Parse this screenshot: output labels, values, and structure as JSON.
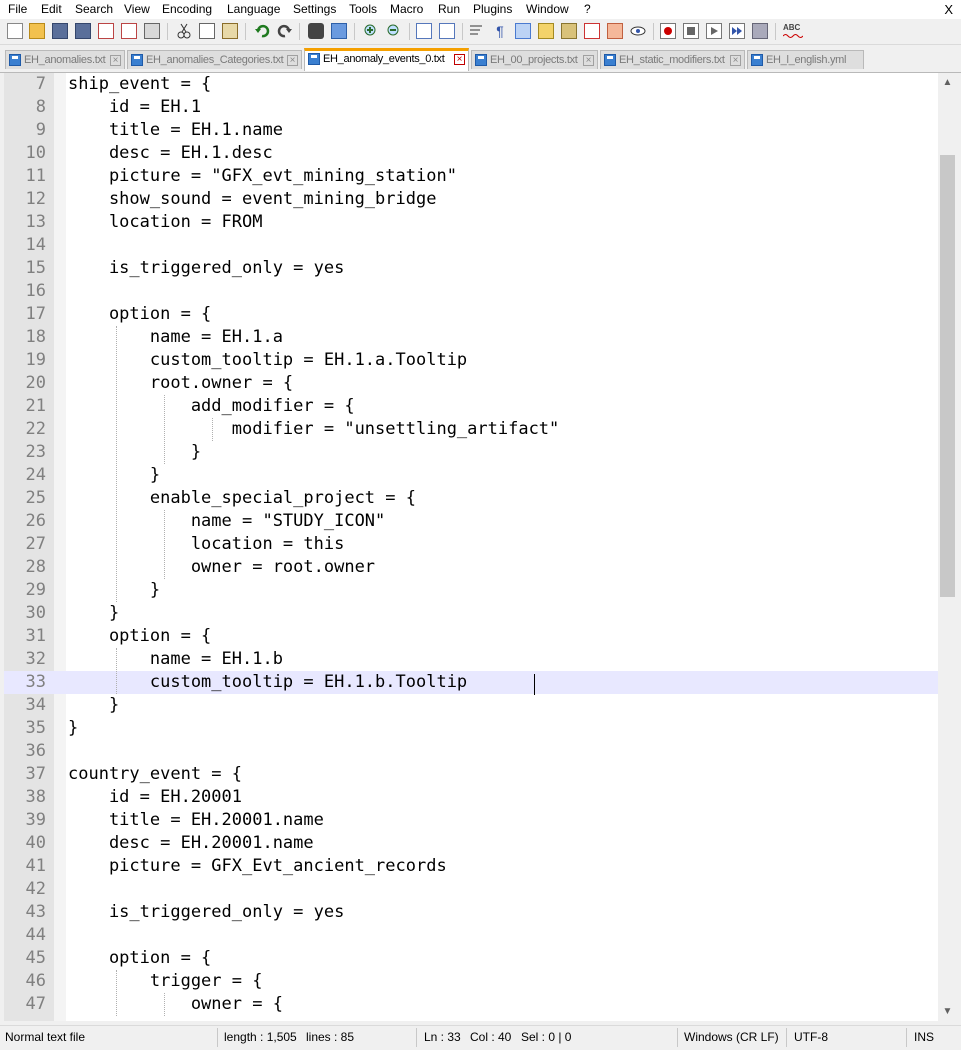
{
  "menu": [
    "File",
    "Edit",
    "Search",
    "View",
    "Encoding",
    "Language",
    "Settings",
    "Tools",
    "Macro",
    "Run",
    "Plugins",
    "Window",
    "?"
  ],
  "close_label": "X",
  "tabs": [
    {
      "label": "EH_anomalies.txt",
      "active": false
    },
    {
      "label": "EH_anomalies_Categories.txt",
      "active": false
    },
    {
      "label": "EH_anomaly_events_0.txt",
      "active": true
    },
    {
      "label": "EH_00_projects.txt",
      "active": false
    },
    {
      "label": "EH_static_modifiers.txt",
      "active": false
    },
    {
      "label": "EH_l_english.yml",
      "active": false
    }
  ],
  "tab_close_glyph": "×",
  "editor": {
    "lines": [
      {
        "n": "7",
        "text": "ship_event = {"
      },
      {
        "n": "8",
        "text": "    id = EH.1"
      },
      {
        "n": "9",
        "text": "    title = EH.1.name"
      },
      {
        "n": "10",
        "text": "    desc = EH.1.desc"
      },
      {
        "n": "11",
        "text": "    picture = \"GFX_evt_mining_station\""
      },
      {
        "n": "12",
        "text": "    show_sound = event_mining_bridge"
      },
      {
        "n": "13",
        "text": "    location = FROM"
      },
      {
        "n": "14",
        "text": ""
      },
      {
        "n": "15",
        "text": "    is_triggered_only = yes"
      },
      {
        "n": "16",
        "text": ""
      },
      {
        "n": "17",
        "text": "    option = {"
      },
      {
        "n": "18",
        "text": "        name = EH.1.a"
      },
      {
        "n": "19",
        "text": "        custom_tooltip = EH.1.a.Tooltip"
      },
      {
        "n": "20",
        "text": "        root.owner = {"
      },
      {
        "n": "21",
        "text": "            add_modifier = {"
      },
      {
        "n": "22",
        "text": "                modifier = \"unsettling_artifact\""
      },
      {
        "n": "23",
        "text": "            }"
      },
      {
        "n": "24",
        "text": "        }"
      },
      {
        "n": "25",
        "text": "        enable_special_project = {"
      },
      {
        "n": "26",
        "text": "            name = \"STUDY_ICON\""
      },
      {
        "n": "27",
        "text": "            location = this"
      },
      {
        "n": "28",
        "text": "            owner = root.owner"
      },
      {
        "n": "29",
        "text": "        }"
      },
      {
        "n": "30",
        "text": "    }"
      },
      {
        "n": "31",
        "text": "    option = {"
      },
      {
        "n": "32",
        "text": "        name = EH.1.b"
      },
      {
        "n": "33",
        "text": "        custom_tooltip = EH.1.b.Tooltip"
      },
      {
        "n": "34",
        "text": "    }"
      },
      {
        "n": "35",
        "text": "}"
      },
      {
        "n": "36",
        "text": ""
      },
      {
        "n": "37",
        "text": "country_event = {"
      },
      {
        "n": "38",
        "text": "    id = EH.20001"
      },
      {
        "n": "39",
        "text": "    title = EH.20001.name"
      },
      {
        "n": "40",
        "text": "    desc = EH.20001.name"
      },
      {
        "n": "41",
        "text": "    picture = GFX_Evt_ancient_records"
      },
      {
        "n": "42",
        "text": ""
      },
      {
        "n": "43",
        "text": "    is_triggered_only = yes"
      },
      {
        "n": "44",
        "text": ""
      },
      {
        "n": "45",
        "text": "    option = {"
      },
      {
        "n": "46",
        "text": "        trigger = {"
      },
      {
        "n": "47",
        "text": "            owner = {"
      }
    ],
    "current_line": "33"
  },
  "status": {
    "file_type": "Normal text file",
    "length": "length : 1,505",
    "lines": "lines : 85",
    "ln": "Ln : 33",
    "col": "Col : 40",
    "sel": "Sel : 0 | 0",
    "eol": "Windows (CR LF)",
    "encoding": "UTF-8",
    "mode": "INS"
  },
  "scrollbar": {
    "up_glyph": "▲",
    "down_glyph": "▼"
  },
  "colors": {
    "active_tab_accent": "#f5a000",
    "current_line": "#e8e8ff",
    "tab_icon": "#3a7fd0"
  }
}
